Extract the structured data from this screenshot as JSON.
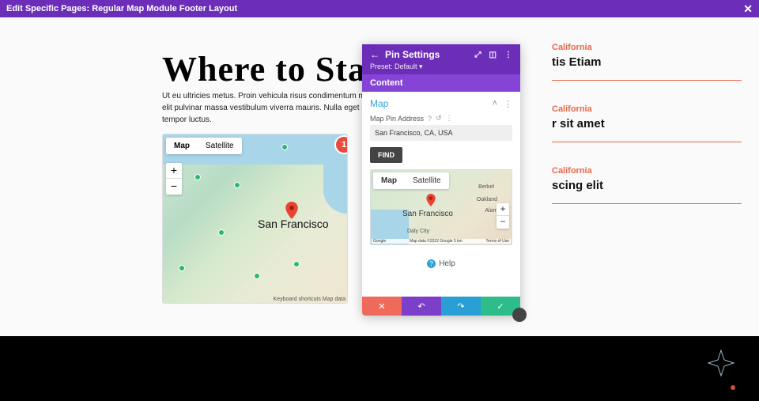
{
  "topbar": {
    "title": "Edit Specific Pages: Regular Map Module Footer Layout"
  },
  "page": {
    "heading": "Where to Stay",
    "paragraph": "Ut eu ultricies metus. Proin vehicula risus condimentum molestie. Integer in elit pulvinar massa vestibulum viverra mauris. Nulla eget ante vitae mi tempor luctus."
  },
  "main_map": {
    "tabs": {
      "map": "Map",
      "satellite": "Satellite"
    },
    "center_label": "San Francisco",
    "credits": "Keyboard shortcuts   Map data",
    "badge": "1"
  },
  "sidebar": {
    "items": [
      {
        "category": "California",
        "title": "tis Etiam"
      },
      {
        "category": "California",
        "title": "r sit amet"
      },
      {
        "category": "California",
        "title": "scing elit"
      }
    ]
  },
  "modal": {
    "title": "Pin Settings",
    "preset": "Preset: Default ▾",
    "tab": "Content",
    "section": "Map",
    "field_label": "Map Pin Address",
    "address_value": "San Francisco, CA, USA",
    "find": "FIND",
    "preview": {
      "tabs": {
        "map": "Map",
        "satellite": "Satellite"
      },
      "sf": "San Francisco",
      "oakland": "Oakland",
      "berkeley": "Berkel",
      "alameda": "Alameda",
      "dalycity": "Daly City",
      "credits_left": "Google",
      "credits_mid": "Map data ©2022 Google    5 km",
      "credits_right": "Terms of Use"
    },
    "help": "Help"
  }
}
